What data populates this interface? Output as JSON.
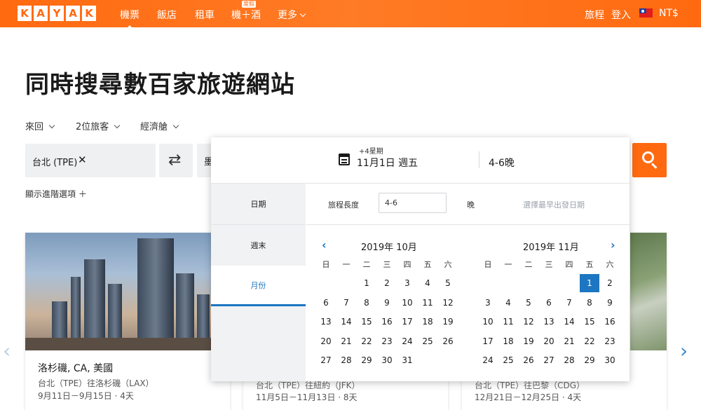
{
  "header": {
    "logo_letters": [
      "K",
      "A",
      "Y",
      "A",
      "K"
    ],
    "nav": [
      {
        "label": "機票",
        "active": true
      },
      {
        "label": "飯店"
      },
      {
        "label": "租車"
      },
      {
        "label": "機＋酒"
      },
      {
        "label": "更多"
      }
    ],
    "package_badge": "度假",
    "trips": "旅程",
    "login": "登入",
    "currency": "NT$"
  },
  "hero": {
    "headline": "同時搜尋數百家旅遊網站",
    "trip_type": "來回",
    "travelers": "2位旅客",
    "cabin": "經濟艙",
    "origin": "台北 (TPE)",
    "destination_partial": "墨",
    "advanced_options": "顯示進階選項 ＋"
  },
  "date_popup": {
    "plus_weeks": "+4星期",
    "departure": "11月1日 週五",
    "nights": "4-6晚",
    "tabs": [
      "日期",
      "週末",
      "月份"
    ],
    "active_tab": 2,
    "trip_length_label": "旅程長度",
    "trip_length_value": "4-6",
    "night_label": "晚",
    "hint": "選擇最早出發日期",
    "weekdays": [
      "日",
      "一",
      "二",
      "三",
      "四",
      "五",
      "六"
    ],
    "months": [
      {
        "title": "2019年 10月",
        "first_weekday": 2,
        "days": 31
      },
      {
        "title": "2019年 11月",
        "first_weekday": 5,
        "days": 30,
        "selected_day": 1
      }
    ]
  },
  "cards": [
    {
      "city": "洛杉磯, CA, 美國",
      "route": "台北（TPE）往洛杉磯（LAX）",
      "dates": "9月11日－9月15日 · 4天"
    },
    {
      "route": "台北（TPE）往紐約（JFK）",
      "dates": "11月5日－11月13日 · 8天"
    },
    {
      "route": "台北（TPE）往巴黎（CDG）",
      "dates": "12月21日－12月25日 · 4天"
    }
  ],
  "colors": {
    "brand": "#ff6a10",
    "accent": "#1d76c2"
  }
}
